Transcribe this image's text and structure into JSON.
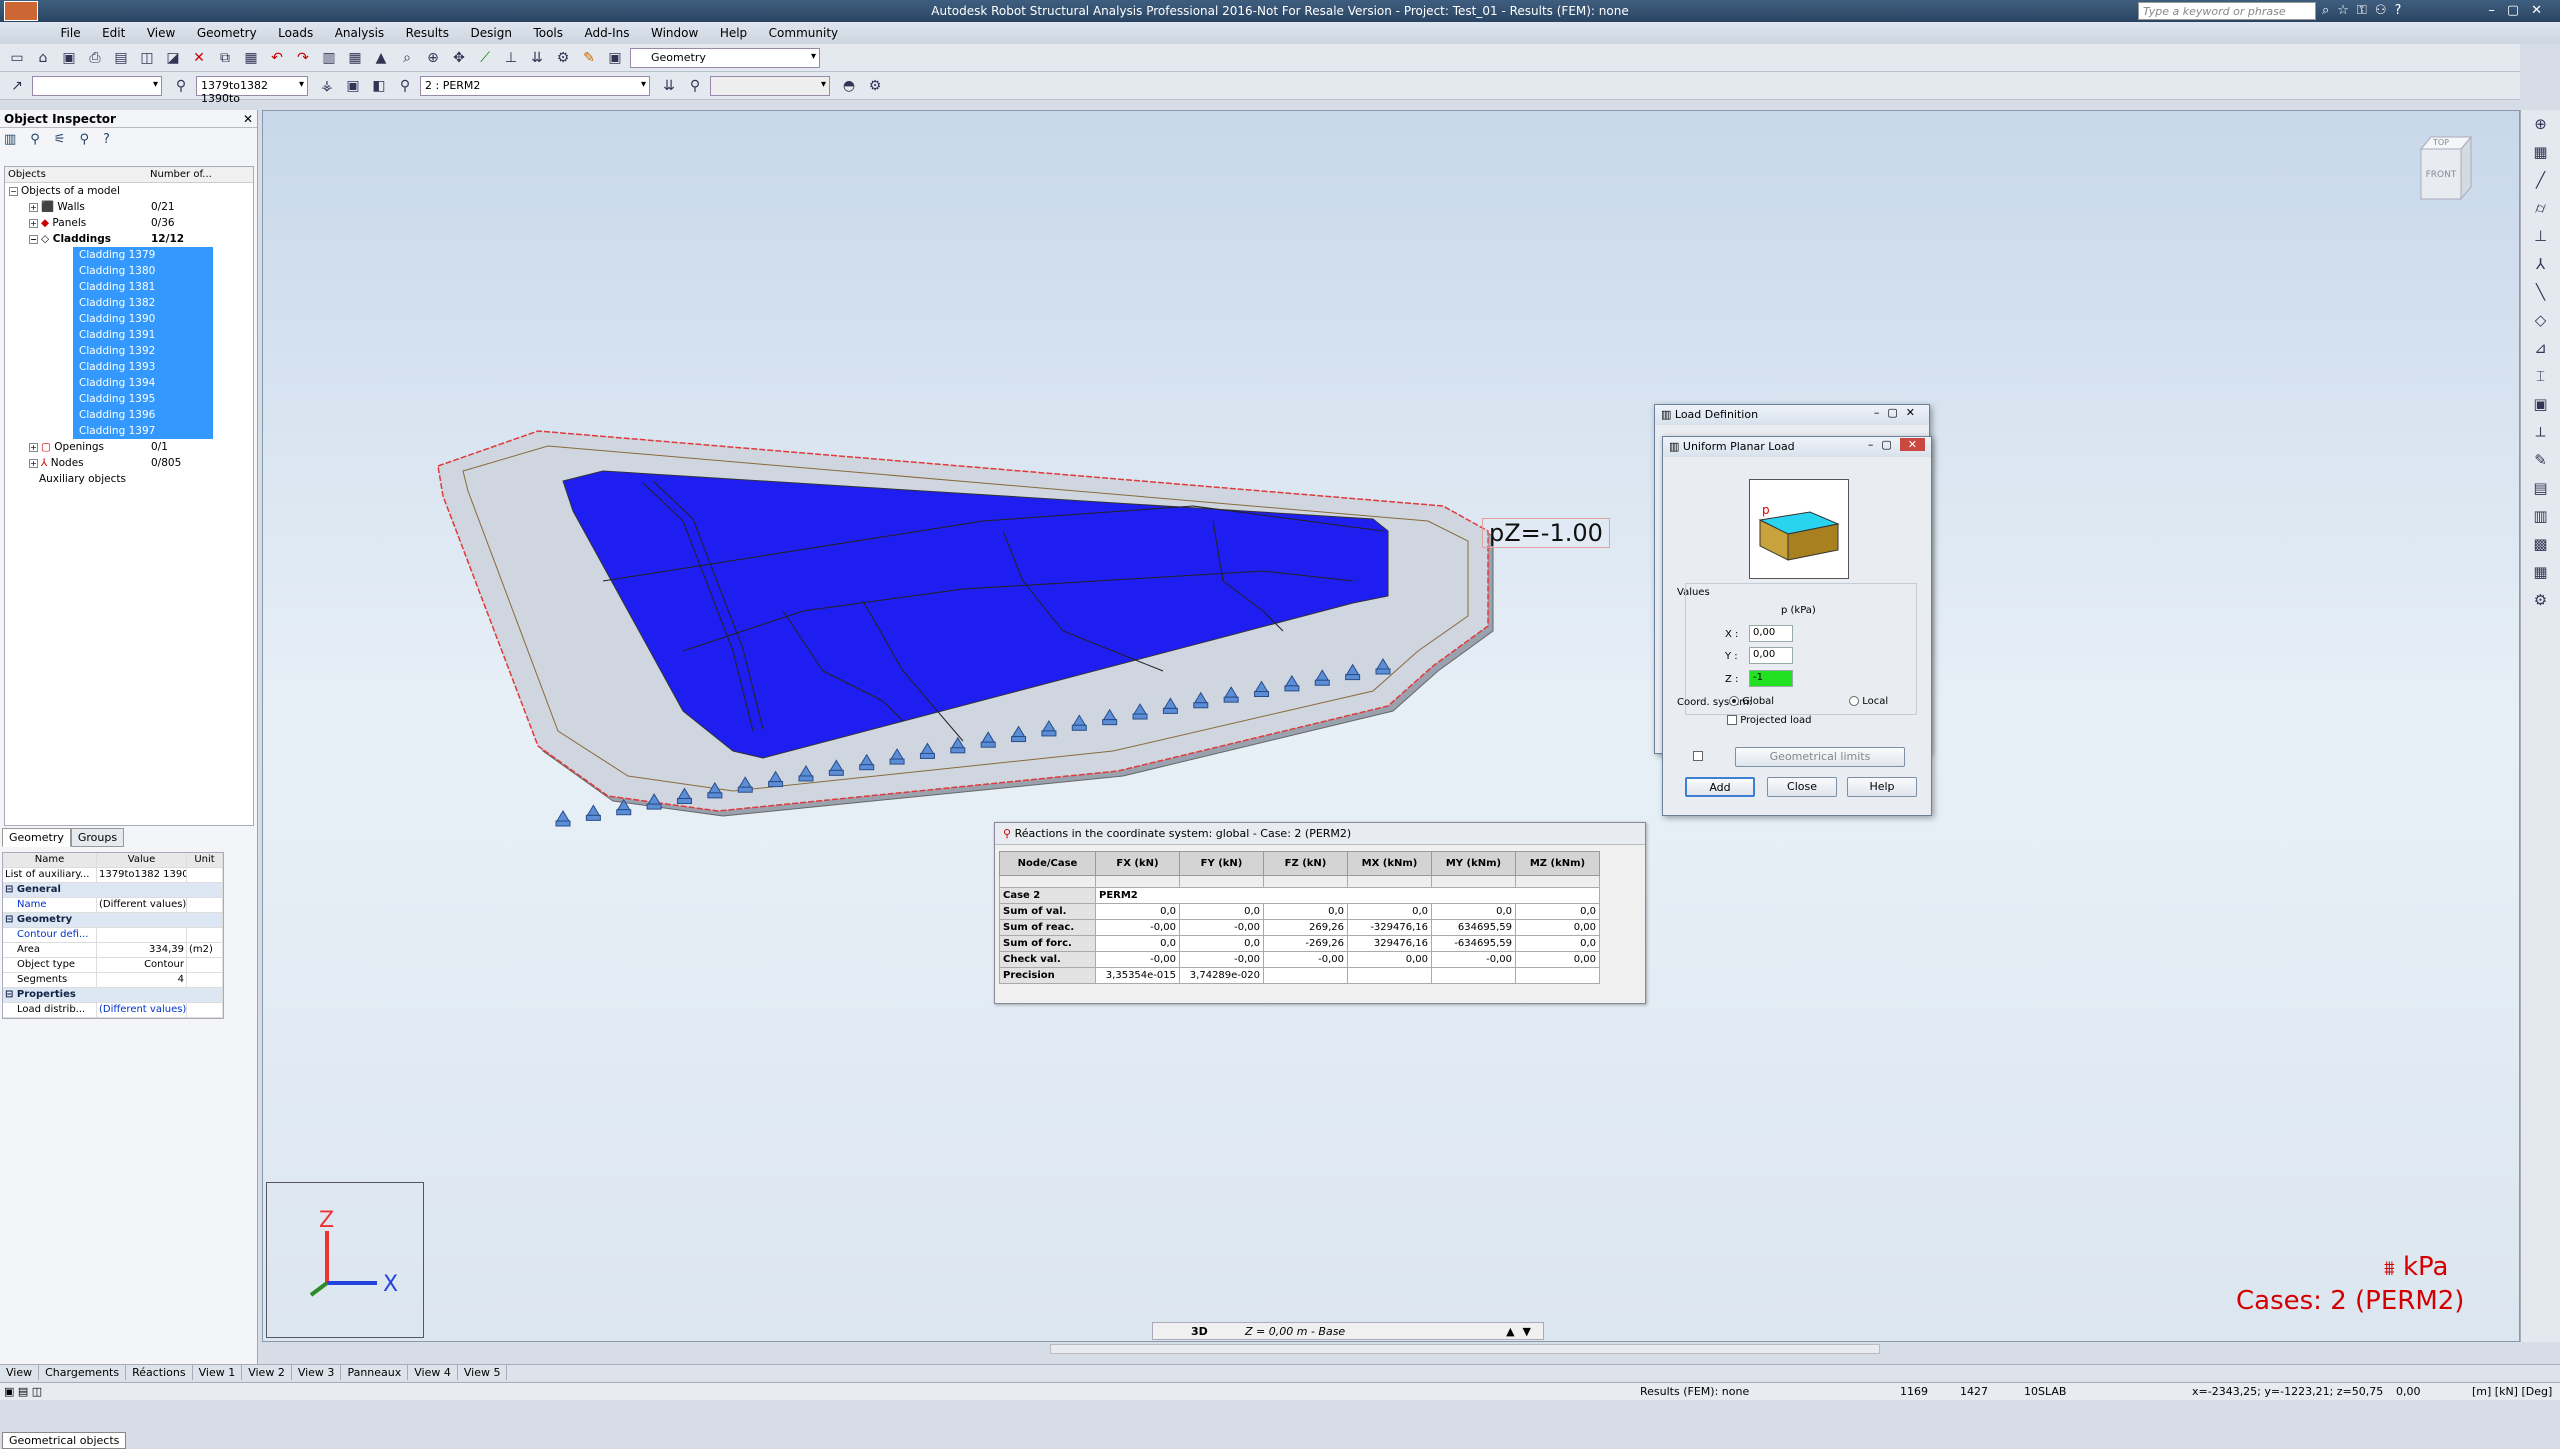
{
  "window": {
    "title": "Autodesk Robot Structural Analysis Professional 2016-Not For Resale Version - Project: Test_01 - Results (FEM): none",
    "search_placeholder": "Type a keyword or phrase"
  },
  "menu": [
    "File",
    "Edit",
    "View",
    "Geometry",
    "Loads",
    "Analysis",
    "Results",
    "Design",
    "Tools",
    "Add-Ins",
    "Window",
    "Help",
    "Community"
  ],
  "toolbar": {
    "layout_combo": "Geometry",
    "selection_combo": "1379to1382 1390to",
    "case_combo": "2 : PERM2"
  },
  "object_inspector": {
    "title": "Object Inspector",
    "columns": [
      "Objects",
      "Number of..."
    ],
    "root": "Objects of a model",
    "items": [
      {
        "label": "Walls",
        "count": "0/21"
      },
      {
        "label": "Panels",
        "count": "0/36"
      },
      {
        "label": "Claddings",
        "count": "12/12"
      }
    ],
    "claddings": [
      "Cladding 1379",
      "Cladding 1380",
      "Cladding 1381",
      "Cladding 1382",
      "Cladding 1390",
      "Cladding 1391",
      "Cladding 1392",
      "Cladding 1393",
      "Cladding 1394",
      "Cladding 1395",
      "Cladding 1396",
      "Cladding 1397"
    ],
    "items_after": [
      {
        "label": "Openings",
        "count": "0/1"
      },
      {
        "label": "Nodes",
        "count": "0/805"
      }
    ],
    "auxiliary": "Auxiliary objects",
    "tabs": [
      "Geometry",
      "Groups"
    ],
    "props_header": [
      "Name",
      "Value",
      "Unit"
    ],
    "props": {
      "list_label": "List of auxiliary...",
      "list_value": "1379to1382 1390to...",
      "general": "General",
      "name_label": "Name",
      "name_value": "(Different values)",
      "geometry": "Geometry",
      "contour_label": "Contour defi...",
      "area_label": "Area",
      "area_value": "334,39",
      "area_unit": "(m2)",
      "type_label": "Object type",
      "type_value": "Contour",
      "segments_label": "Segments",
      "segments_value": "4",
      "properties": "Properties",
      "load_label": "Load distrib...",
      "load_value": "(Different values)"
    },
    "bottom_tab": "Geometrical objects"
  },
  "viewport": {
    "load_label": "pZ=-1.00",
    "axis_z": "Z",
    "axis_x": "X",
    "units": "kPa",
    "cases": "Cases: 2 (PERM2)",
    "view_mode": "3D",
    "plane": "Z = 0,00 m - Base",
    "cube_top": "TOP",
    "cube_front": "FRONT"
  },
  "reactions": {
    "title": "Réactions in the coordinate system: global - Case: 2 (PERM2)",
    "columns": [
      "Node/Case",
      "FX (kN)",
      "FY (kN)",
      "FZ (kN)",
      "MX (kNm)",
      "MY (kNm)",
      "MZ (kNm)"
    ],
    "case_row": [
      "Case 2",
      "PERM2"
    ],
    "rows": [
      [
        "Sum of val.",
        "0,0",
        "0,0",
        "0,0",
        "0,0",
        "0,0",
        "0,0"
      ],
      [
        "Sum of reac.",
        "-0,00",
        "-0,00",
        "269,26",
        "-329476,16",
        "634695,59",
        "0,00"
      ],
      [
        "Sum of forc.",
        "0,0",
        "0,0",
        "-269,26",
        "329476,16",
        "-634695,59",
        "0,0"
      ],
      [
        "Check val.",
        "-0,00",
        "-0,00",
        "-0,00",
        "0,00",
        "-0,00",
        "0,00"
      ],
      [
        "Precision",
        "3,35354e-015",
        "3,74289e-020",
        "",
        "",
        "",
        ""
      ]
    ]
  },
  "load_definition": {
    "title": "Load Definition"
  },
  "planar_load": {
    "title": "Uniform Planar Load",
    "values_label": "Values",
    "unit_label": "p  (kPa)",
    "x_label": "X :",
    "x_value": "0,00",
    "y_label": "Y :",
    "y_value": "0,00",
    "z_label": "Z :",
    "z_value": "-1",
    "coord_label": "Coord. system:",
    "global": "Global",
    "local": "Local",
    "projected": "Projected load",
    "geom_limits": "Geometrical limits",
    "add": "Add",
    "close": "Close",
    "help": "Help"
  },
  "view_tabs": [
    "View",
    "Chargements",
    "Réactions",
    "View 1",
    "View 2",
    "View 3",
    "Panneaux",
    "View 4",
    "View 5"
  ],
  "status": {
    "results": "Results (FEM): none",
    "num1": "1169",
    "num2": "1427",
    "section": "10SLAB",
    "coords": "x=-2343,25; y=-1223,21; z=50,75",
    "angle": "0,00",
    "units": "[m] [kN] [Deg]"
  },
  "colors": {
    "accent": "#3399ff",
    "panel": "#1e1ef0",
    "label_red": "#d30000"
  }
}
